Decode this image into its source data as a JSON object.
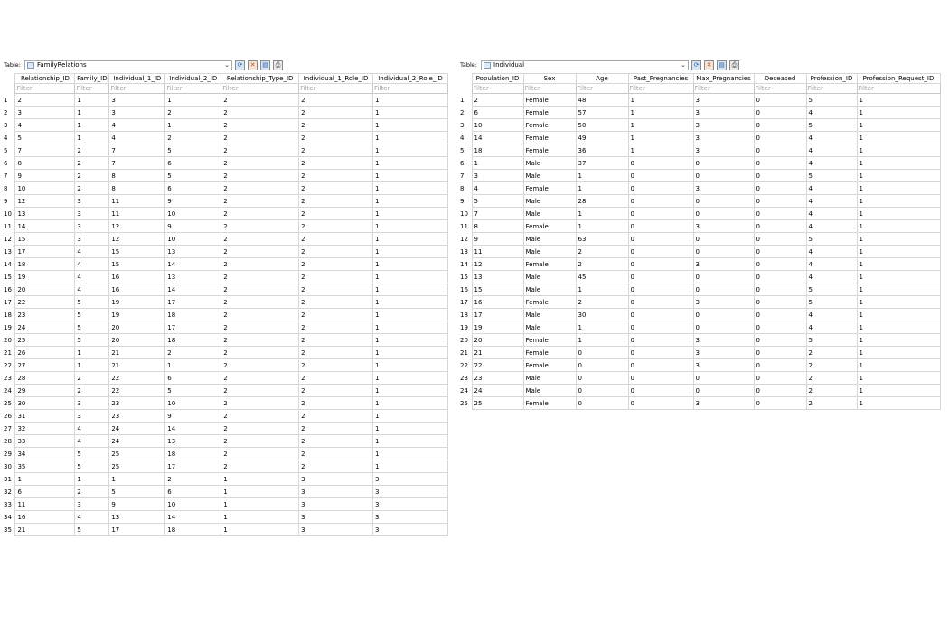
{
  "left": {
    "table_label": "Table:",
    "table_name": "FamilyRelations",
    "filter_placeholder": "Filter",
    "columns": [
      "Relationship_ID",
      "Family_ID",
      "Individual_1_ID",
      "Individual_2_ID",
      "Relationship_Type_ID",
      "Individual_1_Role_ID",
      "Individual_2_Role_ID"
    ],
    "rows": [
      [
        "1",
        "2",
        "1",
        "3",
        "1",
        "2",
        "2",
        "1"
      ],
      [
        "2",
        "3",
        "1",
        "3",
        "2",
        "2",
        "2",
        "1"
      ],
      [
        "3",
        "4",
        "1",
        "4",
        "1",
        "2",
        "2",
        "1"
      ],
      [
        "4",
        "5",
        "1",
        "4",
        "2",
        "2",
        "2",
        "1"
      ],
      [
        "5",
        "7",
        "2",
        "7",
        "5",
        "2",
        "2",
        "1"
      ],
      [
        "6",
        "8",
        "2",
        "7",
        "6",
        "2",
        "2",
        "1"
      ],
      [
        "7",
        "9",
        "2",
        "8",
        "5",
        "2",
        "2",
        "1"
      ],
      [
        "8",
        "10",
        "2",
        "8",
        "6",
        "2",
        "2",
        "1"
      ],
      [
        "9",
        "12",
        "3",
        "11",
        "9",
        "2",
        "2",
        "1"
      ],
      [
        "10",
        "13",
        "3",
        "11",
        "10",
        "2",
        "2",
        "1"
      ],
      [
        "11",
        "14",
        "3",
        "12",
        "9",
        "2",
        "2",
        "1"
      ],
      [
        "12",
        "15",
        "3",
        "12",
        "10",
        "2",
        "2",
        "1"
      ],
      [
        "13",
        "17",
        "4",
        "15",
        "13",
        "2",
        "2",
        "1"
      ],
      [
        "14",
        "18",
        "4",
        "15",
        "14",
        "2",
        "2",
        "1"
      ],
      [
        "15",
        "19",
        "4",
        "16",
        "13",
        "2",
        "2",
        "1"
      ],
      [
        "16",
        "20",
        "4",
        "16",
        "14",
        "2",
        "2",
        "1"
      ],
      [
        "17",
        "22",
        "5",
        "19",
        "17",
        "2",
        "2",
        "1"
      ],
      [
        "18",
        "23",
        "5",
        "19",
        "18",
        "2",
        "2",
        "1"
      ],
      [
        "19",
        "24",
        "5",
        "20",
        "17",
        "2",
        "2",
        "1"
      ],
      [
        "20",
        "25",
        "5",
        "20",
        "18",
        "2",
        "2",
        "1"
      ],
      [
        "21",
        "26",
        "1",
        "21",
        "2",
        "2",
        "2",
        "1"
      ],
      [
        "22",
        "27",
        "1",
        "21",
        "1",
        "2",
        "2",
        "1"
      ],
      [
        "23",
        "28",
        "2",
        "22",
        "6",
        "2",
        "2",
        "1"
      ],
      [
        "24",
        "29",
        "2",
        "22",
        "5",
        "2",
        "2",
        "1"
      ],
      [
        "25",
        "30",
        "3",
        "23",
        "10",
        "2",
        "2",
        "1"
      ],
      [
        "26",
        "31",
        "3",
        "23",
        "9",
        "2",
        "2",
        "1"
      ],
      [
        "27",
        "32",
        "4",
        "24",
        "14",
        "2",
        "2",
        "1"
      ],
      [
        "28",
        "33",
        "4",
        "24",
        "13",
        "2",
        "2",
        "1"
      ],
      [
        "29",
        "34",
        "5",
        "25",
        "18",
        "2",
        "2",
        "1"
      ],
      [
        "30",
        "35",
        "5",
        "25",
        "17",
        "2",
        "2",
        "1"
      ],
      [
        "31",
        "1",
        "1",
        "1",
        "2",
        "1",
        "3",
        "3"
      ],
      [
        "32",
        "6",
        "2",
        "5",
        "6",
        "1",
        "3",
        "3"
      ],
      [
        "33",
        "11",
        "3",
        "9",
        "10",
        "1",
        "3",
        "3"
      ],
      [
        "34",
        "16",
        "4",
        "13",
        "14",
        "1",
        "3",
        "3"
      ],
      [
        "35",
        "21",
        "5",
        "17",
        "18",
        "1",
        "3",
        "3"
      ]
    ]
  },
  "right": {
    "table_label": "Table:",
    "table_name": "Individual",
    "filter_placeholder": "Filter",
    "columns": [
      "Population_ID",
      "Sex",
      "Age",
      "Past_Pregnancies",
      "Max_Pregnancies",
      "Deceased",
      "Profession_ID",
      "Profession_Request_ID"
    ],
    "rows": [
      [
        "1",
        "2",
        "Female",
        "48",
        "1",
        "3",
        "0",
        "5",
        "1"
      ],
      [
        "2",
        "6",
        "Female",
        "57",
        "1",
        "3",
        "0",
        "4",
        "1"
      ],
      [
        "3",
        "10",
        "Female",
        "50",
        "1",
        "3",
        "0",
        "5",
        "1"
      ],
      [
        "4",
        "14",
        "Female",
        "49",
        "1",
        "3",
        "0",
        "4",
        "1"
      ],
      [
        "5",
        "18",
        "Female",
        "36",
        "1",
        "3",
        "0",
        "4",
        "1"
      ],
      [
        "6",
        "1",
        "Male",
        "37",
        "0",
        "0",
        "0",
        "4",
        "1"
      ],
      [
        "7",
        "3",
        "Male",
        "1",
        "0",
        "0",
        "0",
        "5",
        "1"
      ],
      [
        "8",
        "4",
        "Female",
        "1",
        "0",
        "3",
        "0",
        "4",
        "1"
      ],
      [
        "9",
        "5",
        "Male",
        "28",
        "0",
        "0",
        "0",
        "4",
        "1"
      ],
      [
        "10",
        "7",
        "Male",
        "1",
        "0",
        "0",
        "0",
        "4",
        "1"
      ],
      [
        "11",
        "8",
        "Female",
        "1",
        "0",
        "3",
        "0",
        "4",
        "1"
      ],
      [
        "12",
        "9",
        "Male",
        "63",
        "0",
        "0",
        "0",
        "5",
        "1"
      ],
      [
        "13",
        "11",
        "Male",
        "2",
        "0",
        "0",
        "0",
        "4",
        "1"
      ],
      [
        "14",
        "12",
        "Female",
        "2",
        "0",
        "3",
        "0",
        "4",
        "1"
      ],
      [
        "15",
        "13",
        "Male",
        "45",
        "0",
        "0",
        "0",
        "4",
        "1"
      ],
      [
        "16",
        "15",
        "Male",
        "1",
        "0",
        "0",
        "0",
        "5",
        "1"
      ],
      [
        "17",
        "16",
        "Female",
        "2",
        "0",
        "3",
        "0",
        "5",
        "1"
      ],
      [
        "18",
        "17",
        "Male",
        "30",
        "0",
        "0",
        "0",
        "4",
        "1"
      ],
      [
        "19",
        "19",
        "Male",
        "1",
        "0",
        "0",
        "0",
        "4",
        "1"
      ],
      [
        "20",
        "20",
        "Female",
        "1",
        "0",
        "3",
        "0",
        "5",
        "1"
      ],
      [
        "21",
        "21",
        "Female",
        "0",
        "0",
        "3",
        "0",
        "2",
        "1"
      ],
      [
        "22",
        "22",
        "Female",
        "0",
        "0",
        "3",
        "0",
        "2",
        "1"
      ],
      [
        "23",
        "23",
        "Male",
        "0",
        "0",
        "0",
        "0",
        "2",
        "1"
      ],
      [
        "24",
        "24",
        "Male",
        "0",
        "0",
        "0",
        "0",
        "2",
        "1"
      ],
      [
        "25",
        "25",
        "Female",
        "0",
        "0",
        "3",
        "0",
        "2",
        "1"
      ]
    ]
  }
}
